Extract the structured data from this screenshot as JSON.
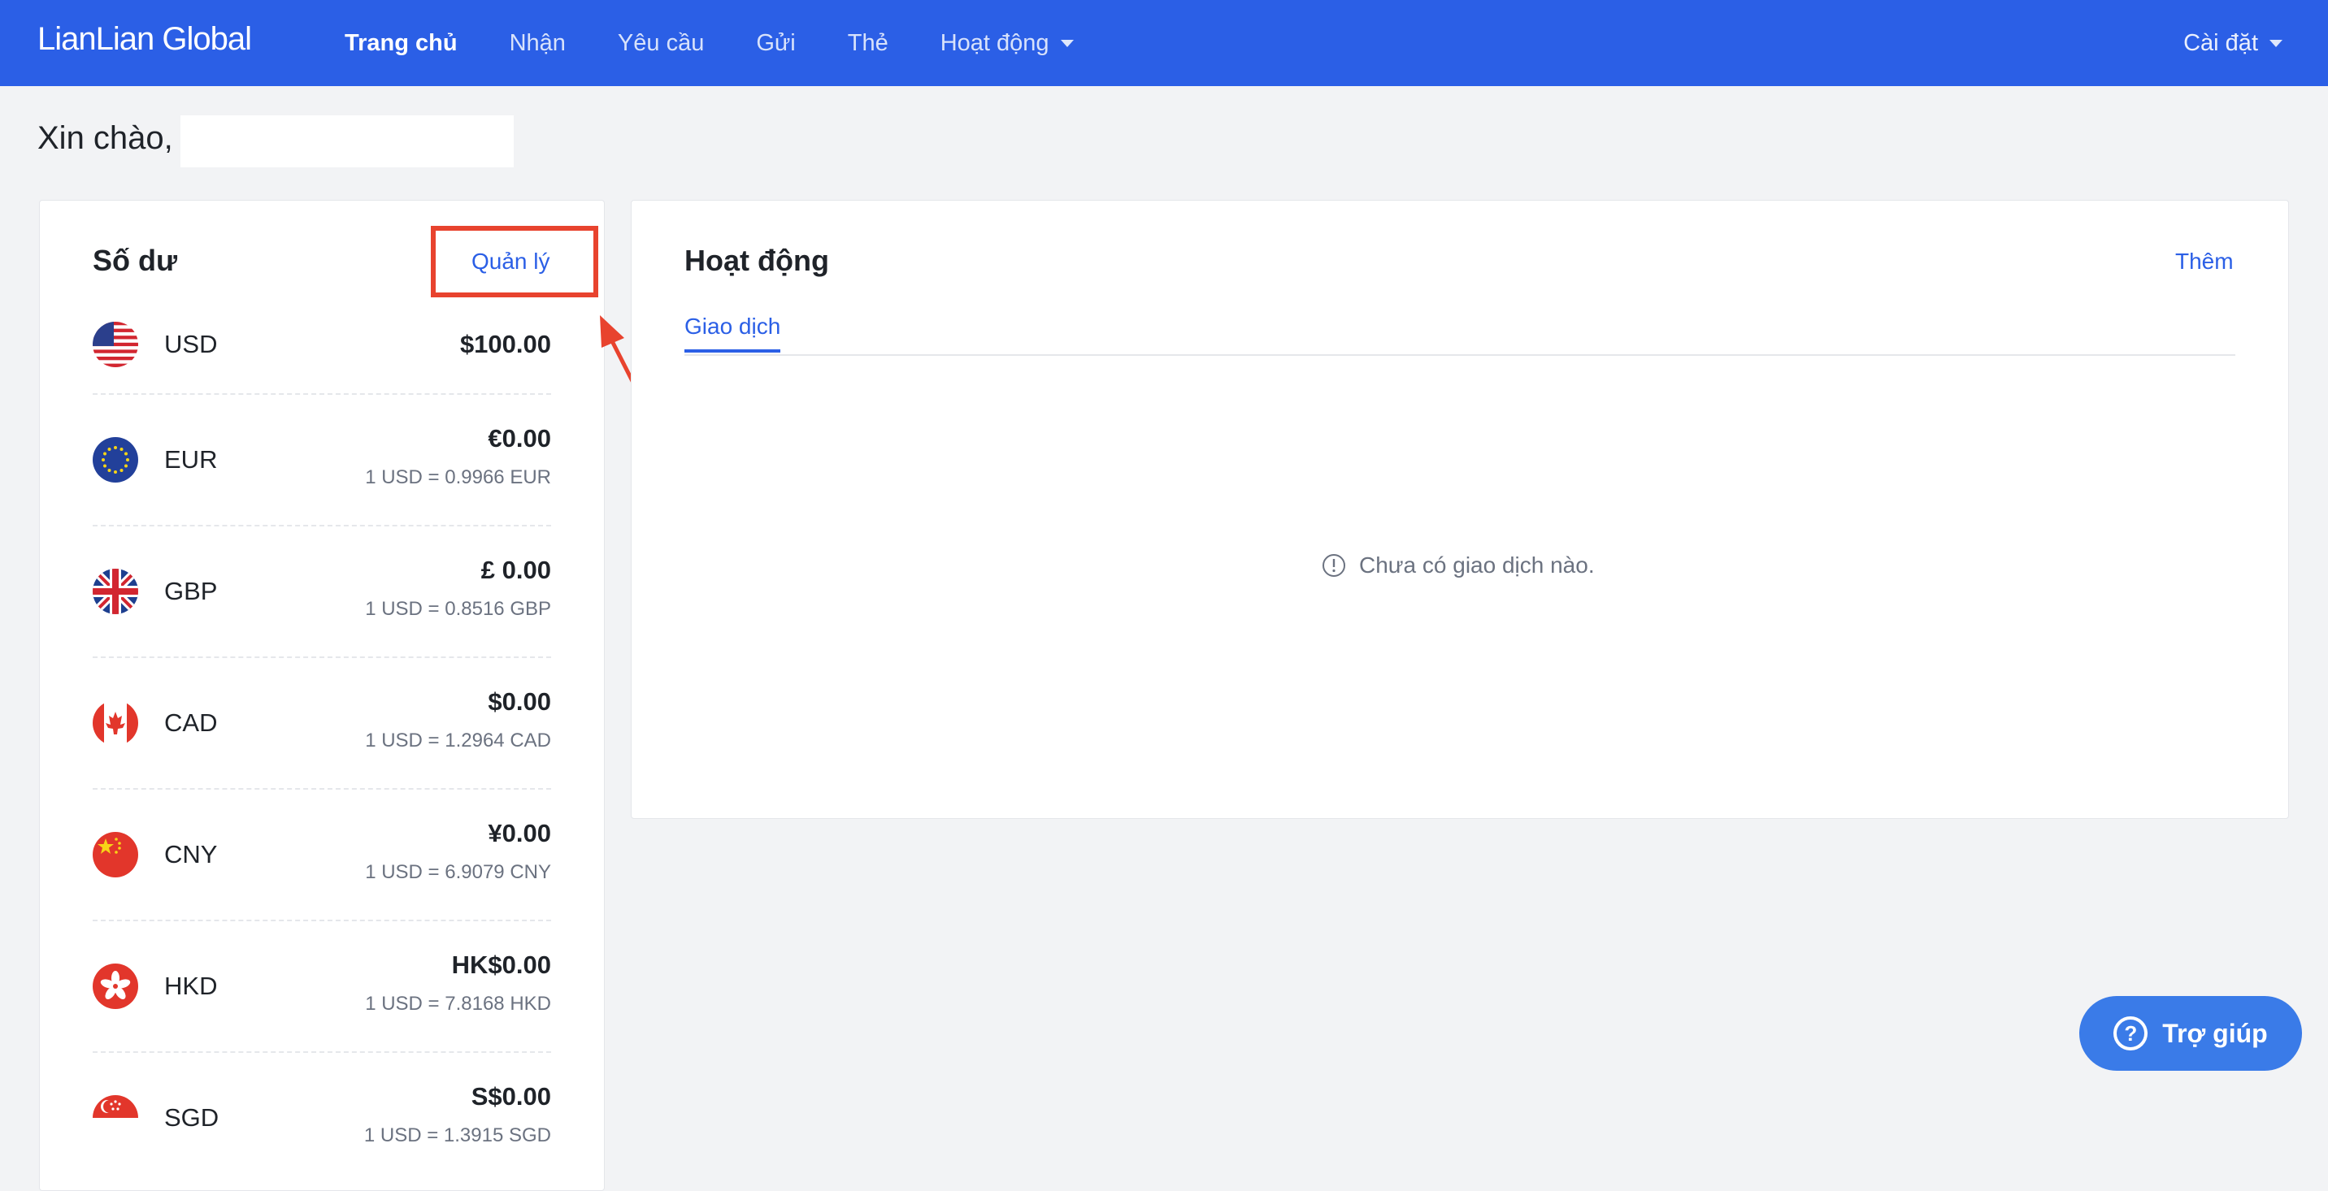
{
  "app": {
    "logo": "LianLian Global"
  },
  "nav": {
    "items": [
      {
        "label": "Trang chủ",
        "active": true
      },
      {
        "label": "Nhận"
      },
      {
        "label": "Yêu cầu"
      },
      {
        "label": "Gửi"
      },
      {
        "label": "Thẻ"
      },
      {
        "label": "Hoạt động",
        "dropdown": true
      }
    ],
    "settings": "Cài đặt"
  },
  "greeting": "Xin chào,",
  "balance": {
    "title": "Số dư",
    "manage": "Quản lý",
    "currencies": [
      {
        "code": "USD",
        "amount": "$100.00",
        "rate": ""
      },
      {
        "code": "EUR",
        "amount": "€0.00",
        "rate": "1 USD = 0.9966 EUR"
      },
      {
        "code": "GBP",
        "amount": "£ 0.00",
        "rate": "1 USD = 0.8516 GBP"
      },
      {
        "code": "CAD",
        "amount": "$0.00",
        "rate": "1 USD = 1.2964 CAD"
      },
      {
        "code": "CNY",
        "amount": "¥0.00",
        "rate": "1 USD = 6.9079 CNY"
      },
      {
        "code": "HKD",
        "amount": "HK$0.00",
        "rate": "1 USD = 7.8168 HKD"
      },
      {
        "code": "SGD",
        "amount": "S$0.00",
        "rate": "1 USD = 1.3915 SGD"
      }
    ]
  },
  "activity": {
    "title": "Hoạt động",
    "more": "Thêm",
    "tab": "Giao dịch",
    "empty": "Chưa có giao dịch nào."
  },
  "help": {
    "label": "Trợ giúp"
  },
  "colors": {
    "brand": "#2b5fe6",
    "highlight": "#e8432e",
    "help": "#3a7be8"
  }
}
